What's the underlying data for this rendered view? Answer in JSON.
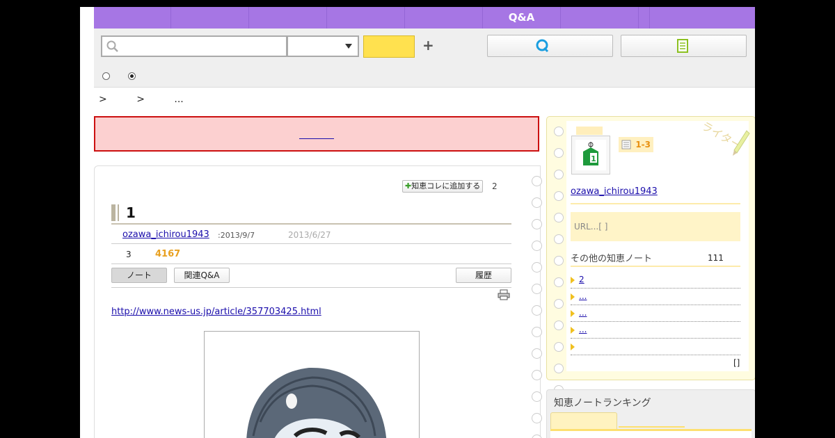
{
  "nav": {
    "tabs": [
      "",
      "",
      "",
      "",
      "",
      "Q&A",
      "",
      "",
      ""
    ]
  },
  "search": {
    "placeholder": "",
    "select_value": "",
    "button_label": ""
  },
  "breadcrumb": [
    ">",
    ">",
    "..."
  ],
  "alert": {
    "link_text": ""
  },
  "note": {
    "add_collection_label": "知恵コレに追加する",
    "add_count": "2",
    "title": "1",
    "author": "ozawa_ichirou1943",
    "date_created": ":2013/9/7",
    "date_updated": "2013/6/27",
    "stat_count": "3",
    "views": "4167",
    "tabs": {
      "note": "ノート",
      "related": "関連Q&A",
      "history": "履歴"
    },
    "source_url": " http://www.news-us.jp/article/357703425.html"
  },
  "sidebar": {
    "rank_label": "1-3",
    "writer_deco": "ライター",
    "author": "ozawa_ichirou1943",
    "url_text": "URL...[          ]",
    "other_notes_label": "その他の知恵ノート",
    "other_notes_count": "111",
    "items": [
      " 2 ",
      "... ",
      " ... ",
      " ... ",
      ""
    ],
    "more": "[]"
  },
  "ranking": {
    "title": "知恵ノートランキング"
  },
  "colors": {
    "nav": "#a676e4",
    "search_button": "#ffe14f",
    "alert_bg": "#fcd0d0",
    "alert_border": "#cc1010",
    "views": "#e8a020"
  }
}
